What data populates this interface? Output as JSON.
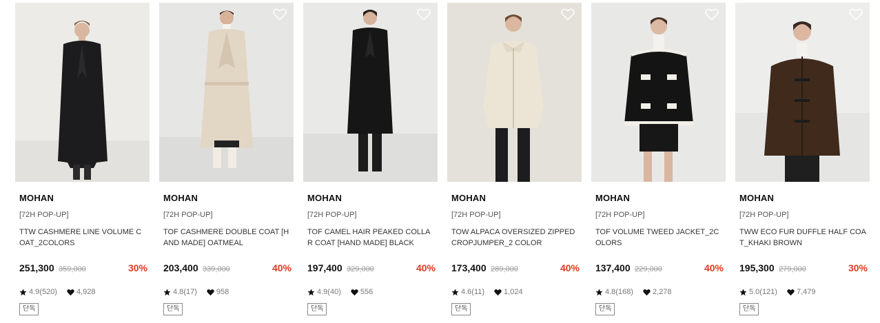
{
  "products": [
    {
      "brand": "MOHAN",
      "tag": "[72H POP-UP]",
      "name": "TTW CASHMERE LINE VOLUME COAT_2COLORS",
      "price": "251,300",
      "original_price": "359,000",
      "discount": "30%",
      "rating": "4.9(520)",
      "likes": "4,928",
      "badge": "단독",
      "icon_rating": "star-icon",
      "icon_likes": "heart-icon"
    },
    {
      "brand": "MOHAN",
      "tag": "[72H POP-UP]",
      "name": "TOF CASHMERE DOUBLE COAT [HAND MADE] OATMEAL",
      "price": "203,400",
      "original_price": "339,000",
      "discount": "40%",
      "rating": "4.8(17)",
      "likes": "958",
      "badge": "단독",
      "icon_rating": "star-icon",
      "icon_likes": "heart-icon"
    },
    {
      "brand": "MOHAN",
      "tag": "[72H POP-UP]",
      "name": "TOF CAMEL HAIR PEAKED COLLAR COAT [HAND MADE] BLACK",
      "price": "197,400",
      "original_price": "329,000",
      "discount": "40%",
      "rating": "4.9(40)",
      "likes": "556",
      "badge": "단독",
      "icon_rating": "star-icon",
      "icon_likes": "heart-icon"
    },
    {
      "brand": "MOHAN",
      "tag": "[72H POP-UP]",
      "name": "TOW ALPACA OVERSIZED ZIPPED CROPJUMPER_2 COLOR",
      "price": "173,400",
      "original_price": "289,000",
      "discount": "40%",
      "rating": "4.6(11)",
      "likes": "1,024",
      "badge": "단독",
      "icon_rating": "star-icon",
      "icon_likes": "heart-icon"
    },
    {
      "brand": "MOHAN",
      "tag": "[72H POP-UP]",
      "name": "TOF VOLUME TWEED JACKET_2COLORS",
      "price": "137,400",
      "original_price": "229,000",
      "discount": "40%",
      "rating": "4.8(168)",
      "likes": "2,278",
      "badge": "단독",
      "icon_rating": "star-icon",
      "icon_likes": "heart-icon"
    },
    {
      "brand": "MOHAN",
      "tag": "[72H POP-UP]",
      "name": "TWW ECO FUR DUFFLE HALF COAT_KHAKI BROWN",
      "price": "195,300",
      "original_price": "279,000",
      "discount": "30%",
      "rating": "5.0(121)",
      "likes": "7,479",
      "badge": "단독",
      "icon_rating": "star-icon",
      "icon_likes": "heart-icon"
    }
  ],
  "colors": {
    "discount": "#e03b1c",
    "price": "#111111",
    "original_price": "#999999"
  }
}
